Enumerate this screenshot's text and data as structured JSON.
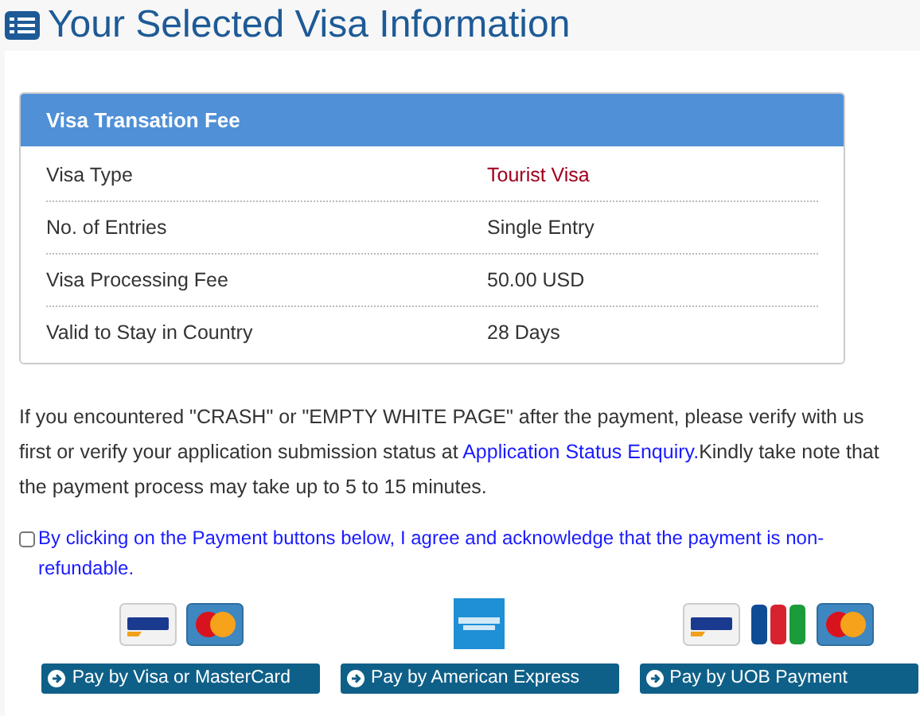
{
  "page_title": "Your Selected Visa Information",
  "fee_panel": {
    "title": "Visa Transation Fee",
    "rows": [
      {
        "label": "Visa Type",
        "value": "Tourist Visa",
        "highlighted": true
      },
      {
        "label": "No. of Entries",
        "value": "Single Entry",
        "highlighted": false
      },
      {
        "label": "Visa Processing Fee",
        "value": "50.00 USD",
        "highlighted": false
      },
      {
        "label": "Valid to Stay in Country",
        "value": "28 Days",
        "highlighted": false
      }
    ]
  },
  "notice": {
    "before": "If you encountered \"CRASH\" or \"EMPTY WHITE PAGE\" after the payment, please verify with us first or verify your application submission status at ",
    "link": "Application Status Enquiry.",
    "after": "Kindly take note that the payment process may take up to 5 to 15 minutes."
  },
  "agreement": {
    "label": "By clicking on the Payment buttons below, I agree and acknowledge that the payment is non-refundable.",
    "checked": false
  },
  "payment_options": [
    {
      "logos": [
        {
          "kind": "visa"
        },
        {
          "kind": "mastercard"
        }
      ],
      "button": "Pay by Visa or MasterCard"
    },
    {
      "logos": [
        {
          "kind": "amex"
        }
      ],
      "button": "Pay by American Express"
    },
    {
      "logos": [
        {
          "kind": "visa"
        },
        {
          "kind": "jcb"
        },
        {
          "kind": "mastercard"
        }
      ],
      "button": "Pay by UOB Payment"
    }
  ]
}
